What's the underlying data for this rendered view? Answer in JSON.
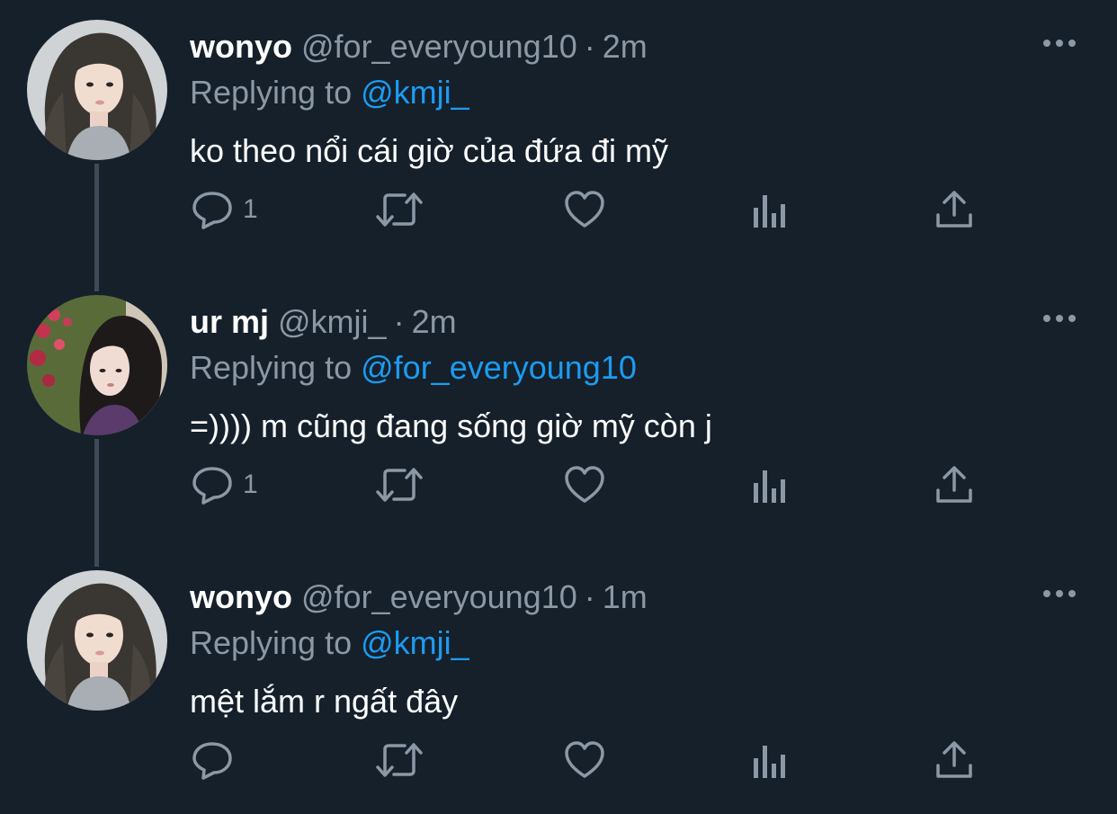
{
  "tweets": [
    {
      "name": "wonyo",
      "handle": "@for_everyoung10",
      "separator": "·",
      "time": "2m",
      "replying_prefix": "Replying to",
      "replying_to": "@kmji_",
      "text": "ko theo nổi cái giờ của đứa đi mỹ",
      "reply_count": "1",
      "avatar_icon": "profile-photo-wonyo"
    },
    {
      "name": "ur mj",
      "handle": "@kmji_",
      "separator": "·",
      "time": "2m",
      "replying_prefix": "Replying to",
      "replying_to": "@for_everyoung10",
      "text": "=)))) m cũng đang sống giờ mỹ còn j",
      "reply_count": "1",
      "avatar_icon": "profile-photo-ur-mj"
    },
    {
      "name": "wonyo",
      "handle": "@for_everyoung10",
      "separator": "·",
      "time": "1m",
      "replying_prefix": "Replying to",
      "replying_to": "@kmji_",
      "text": "mệt lắm r ngất đây",
      "reply_count": "",
      "avatar_icon": "profile-photo-wonyo"
    }
  ],
  "colors": {
    "background": "#15202b",
    "primary_text": "#ffffff",
    "secondary_text": "#8b98a5",
    "accent": "#1d9bf0",
    "thread_line": "#3d4a57"
  },
  "icons": [
    "reply-icon",
    "retweet-icon",
    "like-icon",
    "views-icon",
    "share-icon",
    "more-icon"
  ]
}
